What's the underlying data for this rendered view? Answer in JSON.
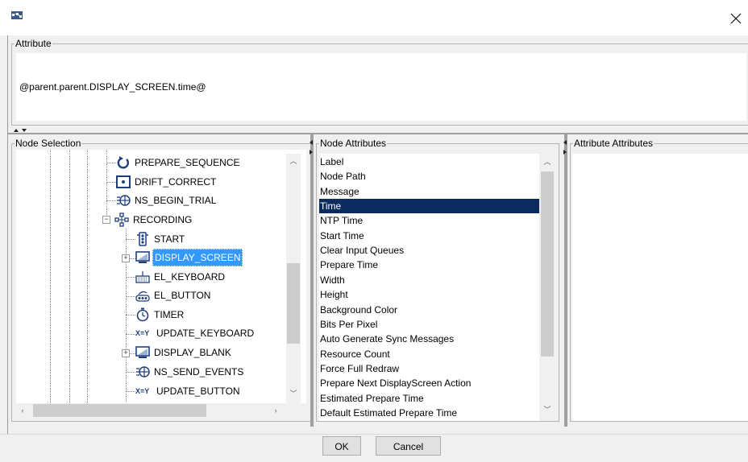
{
  "window": {
    "icon": "node-graph-icon",
    "close_glyph": "✕"
  },
  "attribute": {
    "legend": "Attribute",
    "value": "@parent.parent.DISPLAY_SCREEN.time@"
  },
  "node_selection": {
    "legend": "Node Selection",
    "items": [
      {
        "label": "PREPARE_SEQUENCE",
        "icon": "prepare-sequence-icon"
      },
      {
        "label": "DRIFT_CORRECT",
        "icon": "drift-correct-icon"
      },
      {
        "label": "NS_BEGIN_TRIAL",
        "icon": "network-icon"
      },
      {
        "label": "RECORDING",
        "icon": "recording-icon"
      },
      {
        "label": "START",
        "icon": "start-icon"
      },
      {
        "label": "DISPLAY_SCREEN",
        "icon": "display-screen-icon"
      },
      {
        "label": "EL_KEYBOARD",
        "icon": "keyboard-icon"
      },
      {
        "label": "EL_BUTTON",
        "icon": "button-box-icon"
      },
      {
        "label": "TIMER",
        "icon": "timer-icon"
      },
      {
        "label": "UPDATE_KEYBOARD",
        "icon": "update-attribute-icon",
        "prefix": "X=Y"
      },
      {
        "label": "DISPLAY_BLANK",
        "icon": "display-screen-icon"
      },
      {
        "label": "NS_SEND_EVENTS",
        "icon": "network-icon"
      },
      {
        "label": "UPDATE_BUTTON",
        "icon": "update-attribute-icon",
        "prefix": "X=Y"
      }
    ],
    "selected": "DISPLAY_SCREEN"
  },
  "node_attributes": {
    "legend": "Node Attributes",
    "items": [
      "Label",
      "Node Path",
      "Message",
      "Time",
      "NTP Time",
      "Start Time",
      "Clear Input Queues",
      "Prepare Time",
      "Width",
      "Height",
      "Background Color",
      "Bits Per Pixel",
      "Auto Generate Sync Messages",
      "Resource Count",
      "Force Full Redraw",
      "Prepare Next DisplayScreen Action",
      "Estimated Prepare Time",
      "Default Estimated Prepare Time"
    ],
    "selected": "Time"
  },
  "attribute_attributes": {
    "legend": "Attribute Attributes"
  },
  "buttons": {
    "ok": "OK",
    "cancel": "Cancel"
  },
  "colors": {
    "tree_selection": "#3399ff",
    "list_selection": "#0c2a5e",
    "icon_blue": "#1f3f7a"
  }
}
